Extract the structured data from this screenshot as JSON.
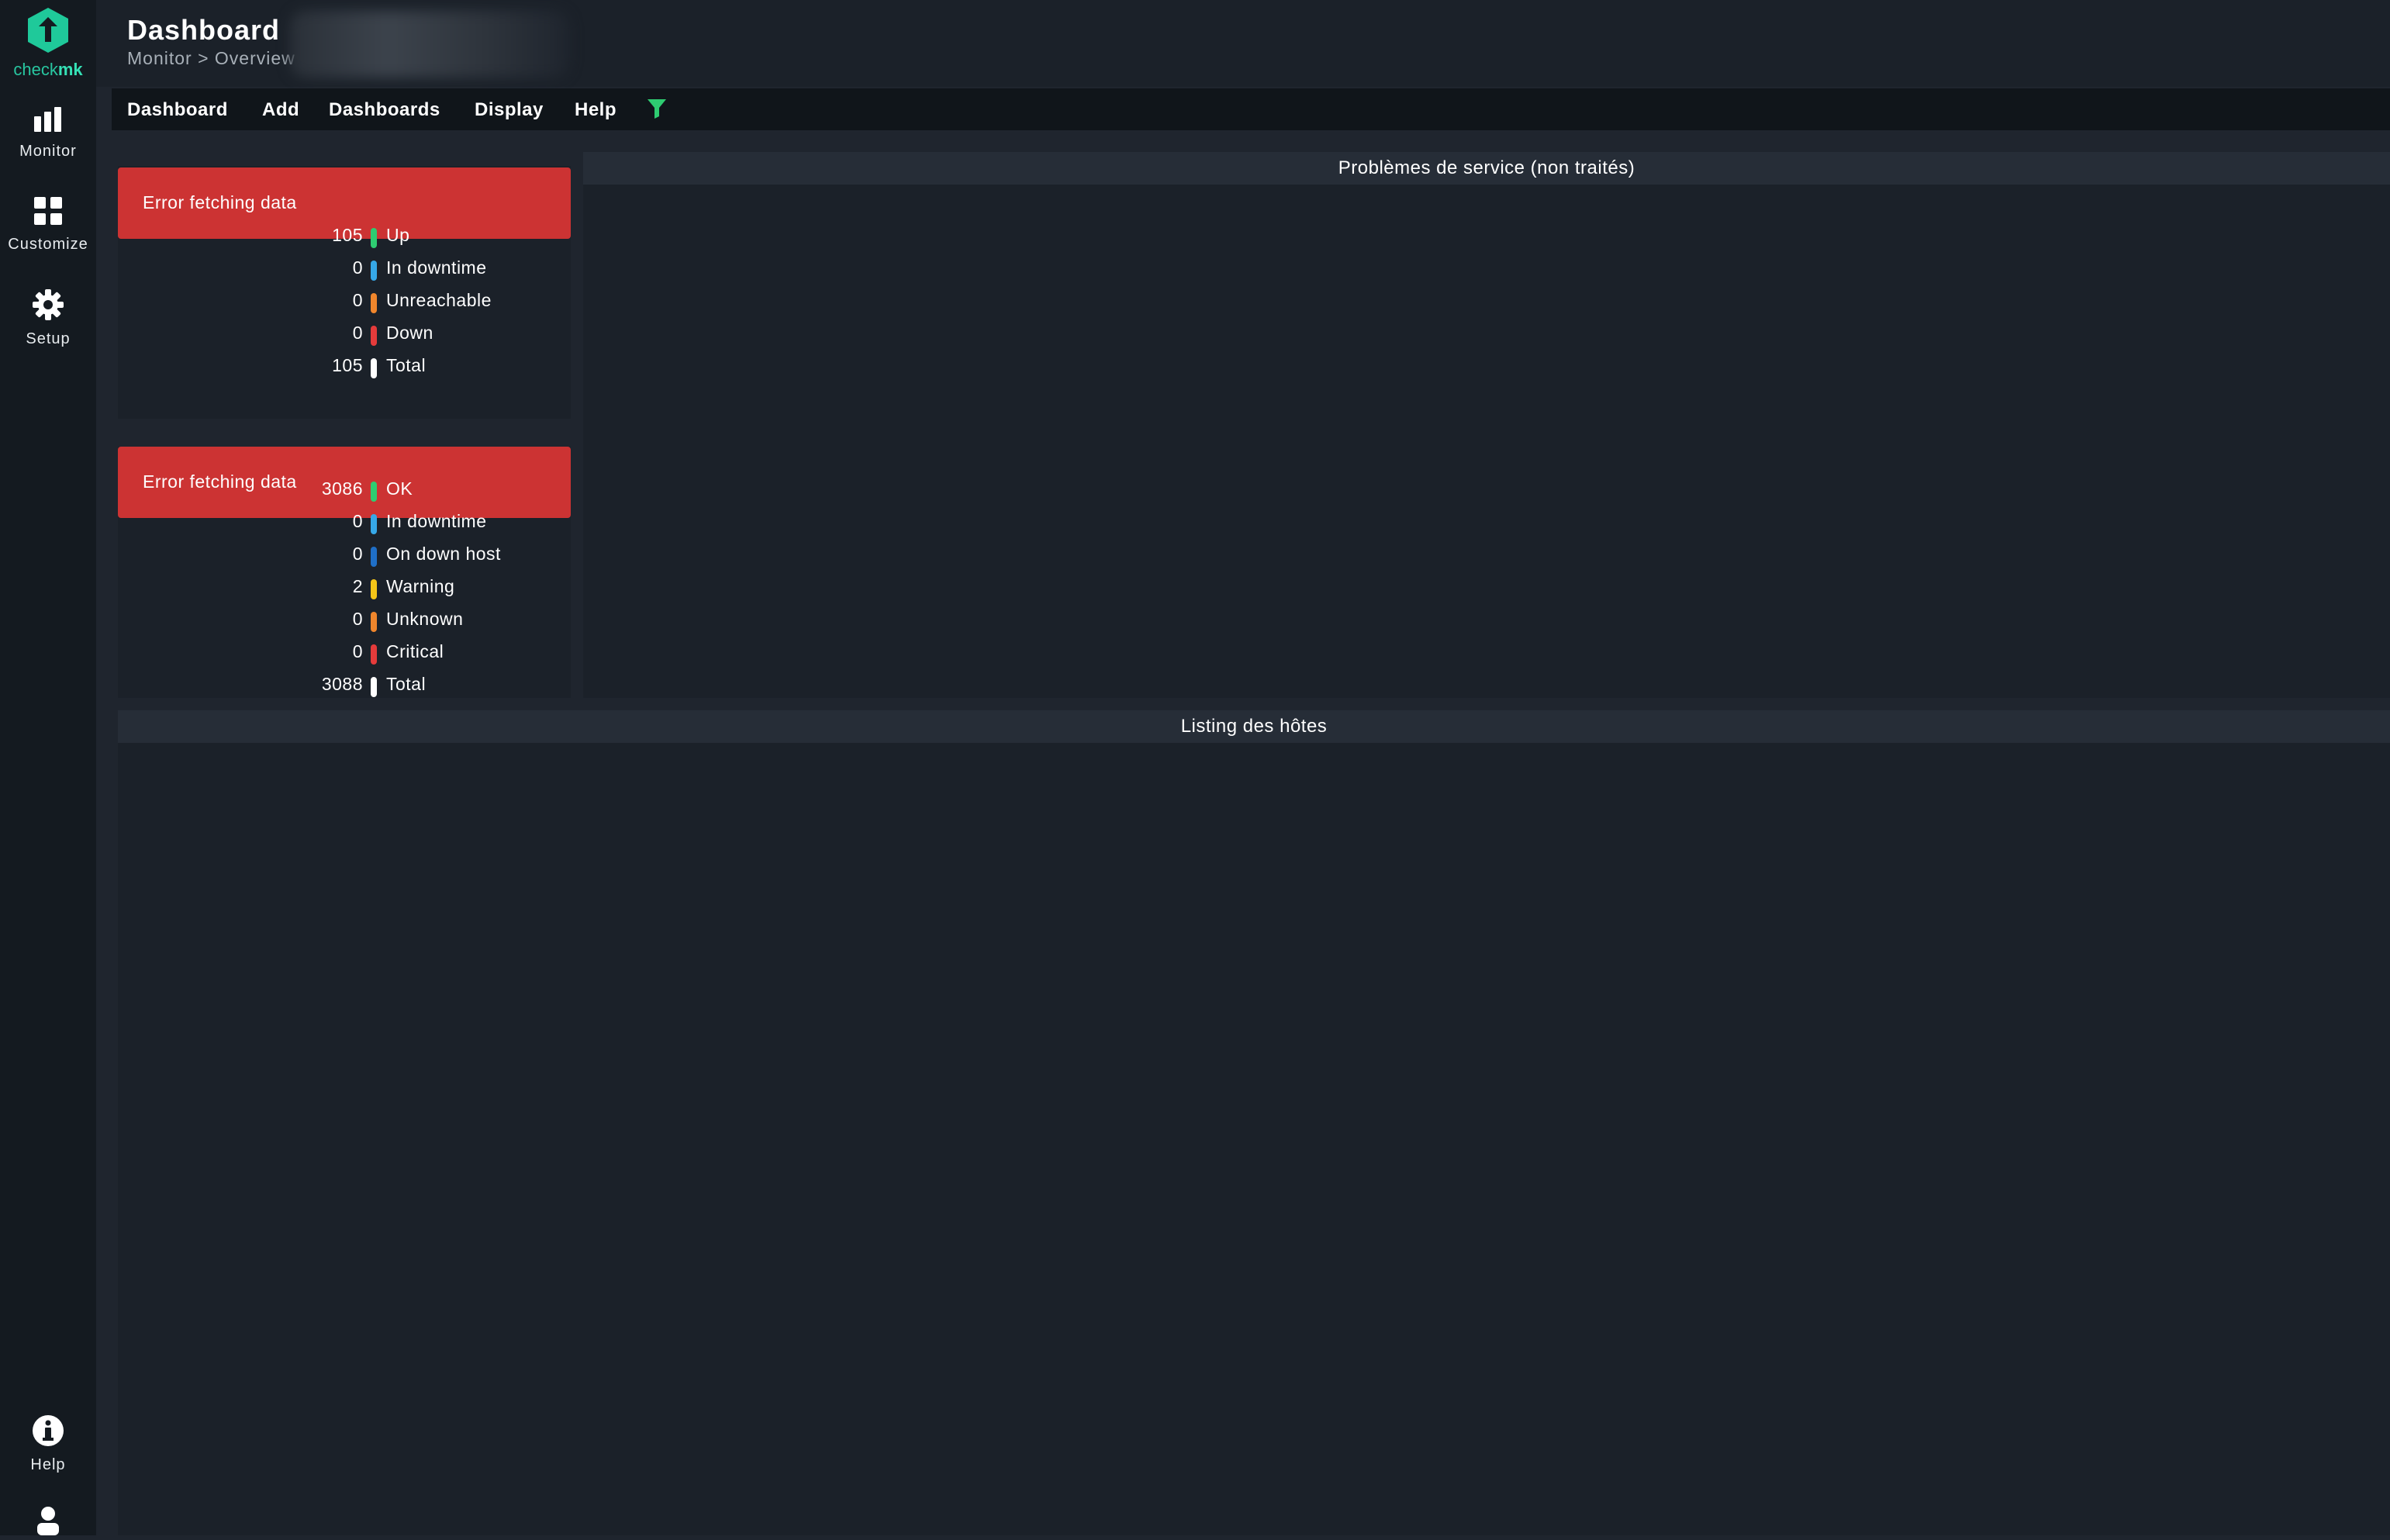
{
  "sidebar": {
    "logo": {
      "part1": "check",
      "part2": "mk"
    },
    "items": [
      {
        "label": "Monitor",
        "icon": "monitor-icon"
      },
      {
        "label": "Customize",
        "icon": "customize-icon"
      },
      {
        "label": "Setup",
        "icon": "gear-icon"
      }
    ],
    "bottom_items": [
      {
        "label": "Help",
        "icon": "help-icon"
      },
      {
        "label": "",
        "icon": "user-icon"
      }
    ]
  },
  "header": {
    "title": "Dashboard",
    "breadcrumb": "Monitor > Overview"
  },
  "menubar": {
    "items": [
      "Dashboard",
      "Add",
      "Dashboards",
      "Display",
      "Help"
    ],
    "filter_icon": "filter-icon"
  },
  "host_stats": {
    "error": "Error fetching data",
    "rows": [
      {
        "count": "105",
        "label": "Up",
        "color": "#2ecc71"
      },
      {
        "count": "0",
        "label": "In downtime",
        "color": "#36a8e8"
      },
      {
        "count": "0",
        "label": "Unreachable",
        "color": "#f0862c"
      },
      {
        "count": "0",
        "label": "Down",
        "color": "#e53b3b"
      },
      {
        "count": "105",
        "label": "Total",
        "color": "#ffffff"
      }
    ]
  },
  "service_stats": {
    "error": "Error fetching data",
    "rows": [
      {
        "count": "3086",
        "label": "OK",
        "color": "#2ecc71"
      },
      {
        "count": "0",
        "label": "In downtime",
        "color": "#36a8e8"
      },
      {
        "count": "0",
        "label": "On down host",
        "color": "#1f6fc7"
      },
      {
        "count": "2",
        "label": "Warning",
        "color": "#f5c518"
      },
      {
        "count": "0",
        "label": "Unknown",
        "color": "#f0862c"
      },
      {
        "count": "0",
        "label": "Critical",
        "color": "#e53b3b"
      },
      {
        "count": "3088",
        "label": "Total",
        "color": "#ffffff"
      }
    ]
  },
  "panels": {
    "service_problems": "Problèmes de service (non traités)",
    "host_listing": "Listing des hôtes"
  }
}
